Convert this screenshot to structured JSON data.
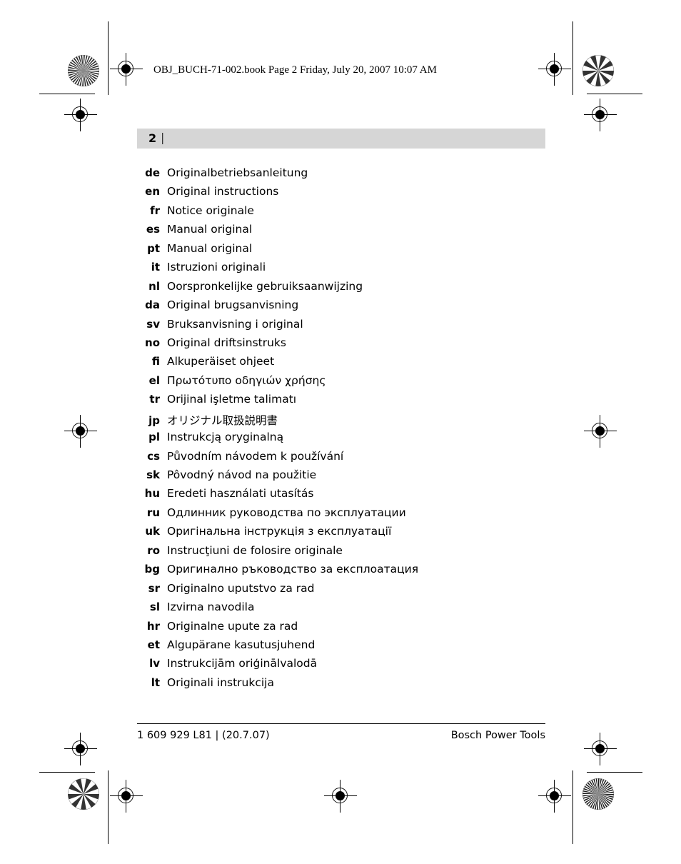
{
  "print_header": {
    "text": "OBJ_BUCH-71-002.book  Page 2  Friday, July 20, 2007  10:07 AM"
  },
  "page_header": {
    "page_number": "2",
    "separator": "|"
  },
  "languages": [
    {
      "code": "de",
      "name": "Originalbetriebsanleitung"
    },
    {
      "code": "en",
      "name": "Original instructions"
    },
    {
      "code": "fr",
      "name": "Notice originale"
    },
    {
      "code": "es",
      "name": "Manual original"
    },
    {
      "code": "pt",
      "name": "Manual original"
    },
    {
      "code": "it",
      "name": "Istruzioni originali"
    },
    {
      "code": "nl",
      "name": "Oorspronkelijke gebruiksaanwijzing"
    },
    {
      "code": "da",
      "name": "Original brugsanvisning"
    },
    {
      "code": "sv",
      "name": "Bruksanvisning i original"
    },
    {
      "code": "no",
      "name": "Original driftsinstruks"
    },
    {
      "code": "fi",
      "name": "Alkuperäiset ohjeet"
    },
    {
      "code": "el",
      "name": "Πρωτότυπο οδηγιών χρήσης"
    },
    {
      "code": "tr",
      "name": "Orijinal işletme talimatı"
    },
    {
      "code": "jp",
      "name": "オリジナル取扱説明書"
    },
    {
      "code": "pl",
      "name": "Instrukcją oryginalną"
    },
    {
      "code": "cs",
      "name": "Původním návodem k používání"
    },
    {
      "code": "sk",
      "name": "Pôvodný návod na použitie"
    },
    {
      "code": "hu",
      "name": "Eredeti használati utasítás"
    },
    {
      "code": "ru",
      "name": "Одлинник руководства по эксплуатации"
    },
    {
      "code": "uk",
      "name": "Оригінальна інструкція з експлуатації"
    },
    {
      "code": "ro",
      "name": "Instrucţiuni de folosire originale"
    },
    {
      "code": "bg",
      "name": "Оригинално ръководство за експлоатация"
    },
    {
      "code": "sr",
      "name": "Originalno uputstvo za rad"
    },
    {
      "code": "sl",
      "name": "Izvirna navodila"
    },
    {
      "code": "hr",
      "name": "Originalne upute za rad"
    },
    {
      "code": "et",
      "name": "Algupärane kasutusjuhend"
    },
    {
      "code": "lv",
      "name": "Instrukcijām oriģinālvalodā"
    },
    {
      "code": "lt",
      "name": "Originali instrukcija"
    }
  ],
  "footer": {
    "left": "1 609 929 L81 | (20.7.07)",
    "right": "Bosch Power Tools"
  },
  "colors": {
    "header_band": "#d6d6d6",
    "text": "#000000"
  }
}
